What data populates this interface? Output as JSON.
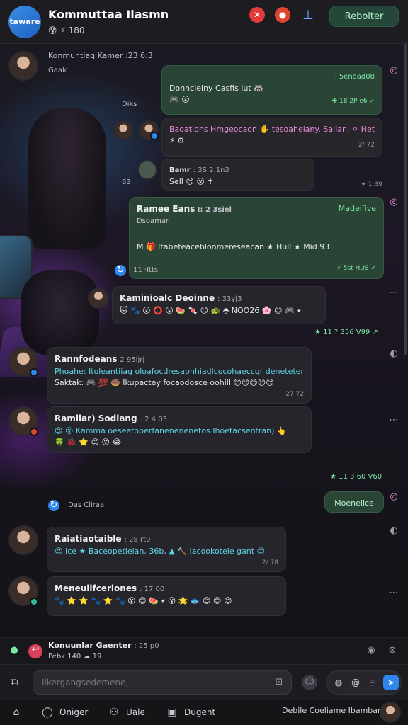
{
  "header": {
    "logo_text": "taware",
    "title": "Kommuttaa Ilasmn",
    "subtitle": "😵 ⚡ 180",
    "icons": [
      "alert-icon",
      "alert-icon",
      "pin-icon",
      "share-icon"
    ],
    "action_button": "Rebolter"
  },
  "messages": [
    {
      "sender": "Konmuntiag Kamer",
      "time": ":23 6:3",
      "preview": "Gaalc"
    },
    {
      "incoming": false,
      "tag": "I' 5enoad08",
      "text1": "Donncieiny Casfis lut 🦝",
      "text2": "🎮 😮",
      "meta": "✤ 18 2P e6 ✓"
    },
    {
      "text": "Baoations Hmgeocaon ✋ tesoaheiany. Sailan. ⚪ Hetik,",
      "line2": "⚡ ⚙",
      "meta": "2/ 72"
    },
    {
      "sender": "Bamr",
      "time": ": 3S 2.1n3",
      "text": "Sell 😊 😮 ✝",
      "meta": "✦ 1:39"
    },
    {
      "sender": "Ramee Eans",
      "time": "I: 2 3siel",
      "tag": "Madeifive",
      "text": "M 🎁 Itabeteaceblonmereseacan ★ Hull ★ Mid 93",
      "meta": "⚡ 5st HUS ✓",
      "reply": "Dsoamar"
    },
    {
      "sender": "Kaminioalc Deoinne",
      "time": ": 33yj3",
      "emoji": "🐱 🐾 😮 ⭕ 😮 🍉 🍬 😊 🐢 ⬘ NOO26 🌸 😊 🎮 ⭑",
      "meta": "★ 11 ? 356 V99 ↗"
    },
    {
      "sender": "Rannfodeans",
      "time": "2 95ljrj",
      "line1": "Phoahe: Itoleantiiag oloafocdresapnhiadlcocohaeccgr deneteten",
      "line2": "Saktak: 🎮 💯 🍩 Ikupactey focaodosce oohill 😊😊😊😊😊",
      "meta": "27 72"
    },
    {
      "sender": "Ramilar) Sodiang",
      "time": ": 2 4 03",
      "line1": "😍 😮 Kamma oeseetoperfanenenenetos Ihoetacsentran) 👆",
      "line2": "🍀 🐞 ⭐ 😊 😮 😂",
      "meta": ""
    },
    {
      "incoming": false,
      "text": "Moenelice",
      "meta": "★ 11 3 60 V60"
    },
    {
      "sender": "Raiatiaotaible",
      "time": ": 28 rt0",
      "text": "😍 Ice ★ Baceopetielan, 36b, ▲ 🔨 Iacookoteie gant 😊",
      "meta": "2/ 78"
    },
    {
      "sender": "Meneulifceriones",
      "time": ": 17 00",
      "emoji": "🐾 ⭐ ⭐ 🐾 ⭐ 🐾 😮 😊 🍉 ⭑ 😮 🌟 🐟 😊 😊 😊"
    }
  ],
  "labels": {
    "chat_tag": "Diks",
    "inline_reply": "Dsoamar",
    "member_label": "Das Ciiraa"
  },
  "composer": {
    "replying_to": "Konuunlar Gaenter",
    "replying_time": ": 25 p0",
    "replying_preview": "Pebk 140 ☁ 19",
    "placeholder": "Ilkergangsedemene,",
    "icons": [
      "sticker-icon",
      "at-icon",
      "gift-icon",
      "send-icon"
    ]
  },
  "nav": {
    "items": [
      {
        "label": "Oniger",
        "icon": "chat-bubble-icon"
      },
      {
        "label": "Uale",
        "icon": "friends-icon"
      },
      {
        "label": "Dugent",
        "icon": "calendar-icon"
      }
    ],
    "right_label": "Debile Coeliame Ibamban"
  },
  "colors": {
    "accent_blue": "#2f86f0",
    "bubble_out": "#2a4536",
    "bubble_in": "#26262c",
    "cyan_text": "#5fd3e6",
    "pink_text": "#e88ad9",
    "green_text": "#7ce8a4"
  }
}
